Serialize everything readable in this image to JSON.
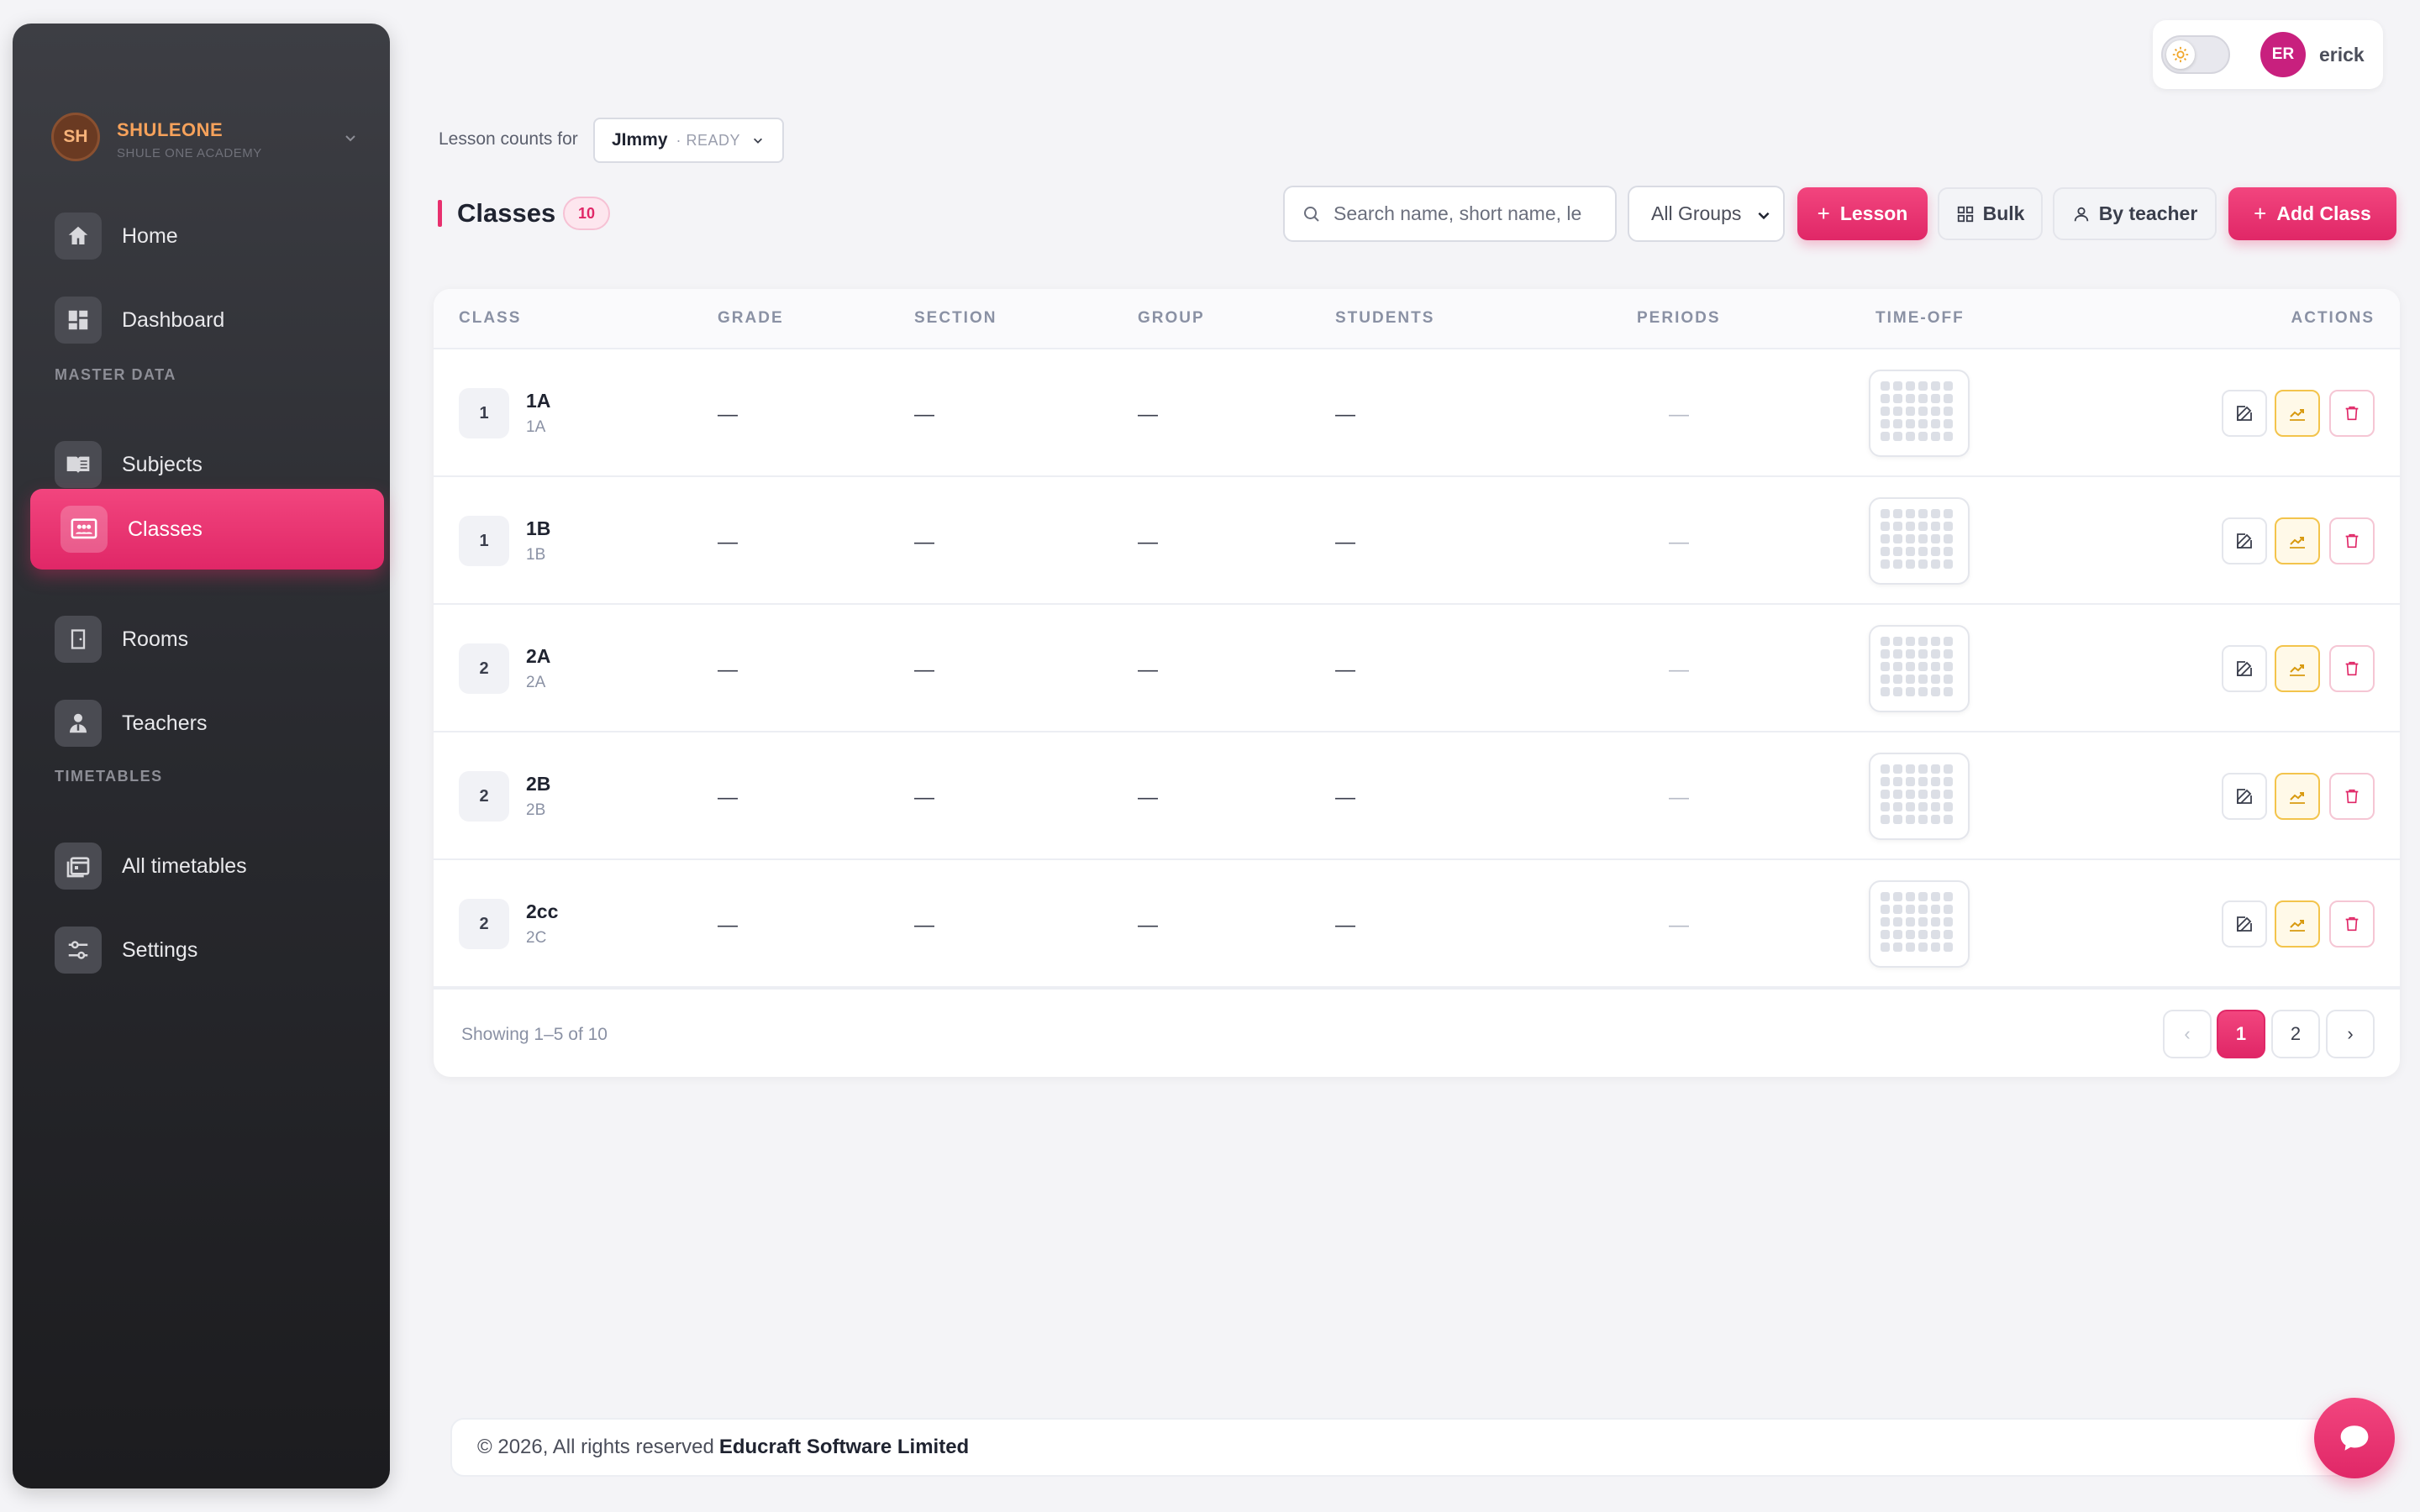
{
  "brand": {
    "initials": "SH",
    "name": "SHULEONE",
    "subtitle": "SHULE ONE ACADEMY"
  },
  "sidebar": {
    "items": [
      {
        "label": "Home",
        "icon": "home-icon"
      },
      {
        "label": "Dashboard",
        "icon": "dashboard-icon"
      },
      {
        "label": "Subjects",
        "icon": "book-icon"
      },
      {
        "label": "Classes",
        "icon": "class-board-icon",
        "active": true
      },
      {
        "label": "Rooms",
        "icon": "door-icon"
      },
      {
        "label": "Teachers",
        "icon": "teacher-icon"
      },
      {
        "label": "All timetables",
        "icon": "calendar-stack-icon"
      },
      {
        "label": "Settings",
        "icon": "sliders-icon"
      }
    ],
    "sections": {
      "master_data": "MASTER DATA",
      "timetables": "TIMETABLES"
    }
  },
  "user": {
    "initials": "ER",
    "name": "erick"
  },
  "lesson_counts": {
    "label": "Lesson counts for",
    "selected_name": "JImmy",
    "selected_status": "· READY"
  },
  "header": {
    "title": "Classes",
    "count": "10",
    "search_placeholder": "Search name, short name, le",
    "group_filter": "All Groups",
    "lesson_button": "Lesson",
    "bulk_button": "Bulk",
    "by_teacher_button": "By teacher",
    "add_class_button": "Add Class"
  },
  "table": {
    "columns": [
      "CLASS",
      "GRADE",
      "SECTION",
      "GROUP",
      "STUDENTS",
      "PERIODS",
      "TIME-OFF",
      "ACTIONS"
    ],
    "rows": [
      {
        "num": "1",
        "name": "1A",
        "short": "1A",
        "grade": "—",
        "section": "—",
        "group": "—",
        "students": "—",
        "periods": "—"
      },
      {
        "num": "1",
        "name": "1B",
        "short": "1B",
        "grade": "—",
        "section": "—",
        "group": "—",
        "students": "—",
        "periods": "—"
      },
      {
        "num": "2",
        "name": "2A",
        "short": "2A",
        "grade": "—",
        "section": "—",
        "group": "—",
        "students": "—",
        "periods": "—"
      },
      {
        "num": "2",
        "name": "2B",
        "short": "2B",
        "grade": "—",
        "section": "—",
        "group": "—",
        "students": "—",
        "periods": "—"
      },
      {
        "num": "2",
        "name": "2cc",
        "short": "2C",
        "grade": "—",
        "section": "—",
        "group": "—",
        "students": "—",
        "periods": "—"
      }
    ],
    "showing": "Showing 1–5 of 10",
    "pagination": {
      "prev": "‹",
      "pages": [
        "1",
        "2"
      ],
      "current": "1",
      "next": "›"
    }
  },
  "footer": {
    "text": "© 2026, All rights reserved",
    "company": "Educraft Software Limited"
  },
  "colors": {
    "accent": "#e8306e",
    "sidebar_bg": "#2a2b30",
    "brand": "#f6a25b"
  }
}
